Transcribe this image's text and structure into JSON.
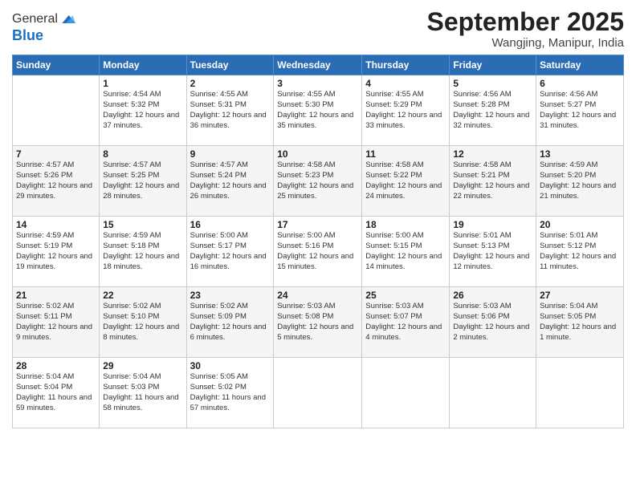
{
  "header": {
    "logo_line1": "General",
    "logo_line2": "Blue",
    "month_title": "September 2025",
    "location": "Wangjing, Manipur, India"
  },
  "days_of_week": [
    "Sunday",
    "Monday",
    "Tuesday",
    "Wednesday",
    "Thursday",
    "Friday",
    "Saturday"
  ],
  "weeks": [
    [
      {
        "day": "",
        "sunrise": "",
        "sunset": "",
        "daylight": ""
      },
      {
        "day": "1",
        "sunrise": "Sunrise: 4:54 AM",
        "sunset": "Sunset: 5:32 PM",
        "daylight": "Daylight: 12 hours and 37 minutes."
      },
      {
        "day": "2",
        "sunrise": "Sunrise: 4:55 AM",
        "sunset": "Sunset: 5:31 PM",
        "daylight": "Daylight: 12 hours and 36 minutes."
      },
      {
        "day": "3",
        "sunrise": "Sunrise: 4:55 AM",
        "sunset": "Sunset: 5:30 PM",
        "daylight": "Daylight: 12 hours and 35 minutes."
      },
      {
        "day": "4",
        "sunrise": "Sunrise: 4:55 AM",
        "sunset": "Sunset: 5:29 PM",
        "daylight": "Daylight: 12 hours and 33 minutes."
      },
      {
        "day": "5",
        "sunrise": "Sunrise: 4:56 AM",
        "sunset": "Sunset: 5:28 PM",
        "daylight": "Daylight: 12 hours and 32 minutes."
      },
      {
        "day": "6",
        "sunrise": "Sunrise: 4:56 AM",
        "sunset": "Sunset: 5:27 PM",
        "daylight": "Daylight: 12 hours and 31 minutes."
      }
    ],
    [
      {
        "day": "7",
        "sunrise": "Sunrise: 4:57 AM",
        "sunset": "Sunset: 5:26 PM",
        "daylight": "Daylight: 12 hours and 29 minutes."
      },
      {
        "day": "8",
        "sunrise": "Sunrise: 4:57 AM",
        "sunset": "Sunset: 5:25 PM",
        "daylight": "Daylight: 12 hours and 28 minutes."
      },
      {
        "day": "9",
        "sunrise": "Sunrise: 4:57 AM",
        "sunset": "Sunset: 5:24 PM",
        "daylight": "Daylight: 12 hours and 26 minutes."
      },
      {
        "day": "10",
        "sunrise": "Sunrise: 4:58 AM",
        "sunset": "Sunset: 5:23 PM",
        "daylight": "Daylight: 12 hours and 25 minutes."
      },
      {
        "day": "11",
        "sunrise": "Sunrise: 4:58 AM",
        "sunset": "Sunset: 5:22 PM",
        "daylight": "Daylight: 12 hours and 24 minutes."
      },
      {
        "day": "12",
        "sunrise": "Sunrise: 4:58 AM",
        "sunset": "Sunset: 5:21 PM",
        "daylight": "Daylight: 12 hours and 22 minutes."
      },
      {
        "day": "13",
        "sunrise": "Sunrise: 4:59 AM",
        "sunset": "Sunset: 5:20 PM",
        "daylight": "Daylight: 12 hours and 21 minutes."
      }
    ],
    [
      {
        "day": "14",
        "sunrise": "Sunrise: 4:59 AM",
        "sunset": "Sunset: 5:19 PM",
        "daylight": "Daylight: 12 hours and 19 minutes."
      },
      {
        "day": "15",
        "sunrise": "Sunrise: 4:59 AM",
        "sunset": "Sunset: 5:18 PM",
        "daylight": "Daylight: 12 hours and 18 minutes."
      },
      {
        "day": "16",
        "sunrise": "Sunrise: 5:00 AM",
        "sunset": "Sunset: 5:17 PM",
        "daylight": "Daylight: 12 hours and 16 minutes."
      },
      {
        "day": "17",
        "sunrise": "Sunrise: 5:00 AM",
        "sunset": "Sunset: 5:16 PM",
        "daylight": "Daylight: 12 hours and 15 minutes."
      },
      {
        "day": "18",
        "sunrise": "Sunrise: 5:00 AM",
        "sunset": "Sunset: 5:15 PM",
        "daylight": "Daylight: 12 hours and 14 minutes."
      },
      {
        "day": "19",
        "sunrise": "Sunrise: 5:01 AM",
        "sunset": "Sunset: 5:13 PM",
        "daylight": "Daylight: 12 hours and 12 minutes."
      },
      {
        "day": "20",
        "sunrise": "Sunrise: 5:01 AM",
        "sunset": "Sunset: 5:12 PM",
        "daylight": "Daylight: 12 hours and 11 minutes."
      }
    ],
    [
      {
        "day": "21",
        "sunrise": "Sunrise: 5:02 AM",
        "sunset": "Sunset: 5:11 PM",
        "daylight": "Daylight: 12 hours and 9 minutes."
      },
      {
        "day": "22",
        "sunrise": "Sunrise: 5:02 AM",
        "sunset": "Sunset: 5:10 PM",
        "daylight": "Daylight: 12 hours and 8 minutes."
      },
      {
        "day": "23",
        "sunrise": "Sunrise: 5:02 AM",
        "sunset": "Sunset: 5:09 PM",
        "daylight": "Daylight: 12 hours and 6 minutes."
      },
      {
        "day": "24",
        "sunrise": "Sunrise: 5:03 AM",
        "sunset": "Sunset: 5:08 PM",
        "daylight": "Daylight: 12 hours and 5 minutes."
      },
      {
        "day": "25",
        "sunrise": "Sunrise: 5:03 AM",
        "sunset": "Sunset: 5:07 PM",
        "daylight": "Daylight: 12 hours and 4 minutes."
      },
      {
        "day": "26",
        "sunrise": "Sunrise: 5:03 AM",
        "sunset": "Sunset: 5:06 PM",
        "daylight": "Daylight: 12 hours and 2 minutes."
      },
      {
        "day": "27",
        "sunrise": "Sunrise: 5:04 AM",
        "sunset": "Sunset: 5:05 PM",
        "daylight": "Daylight: 12 hours and 1 minute."
      }
    ],
    [
      {
        "day": "28",
        "sunrise": "Sunrise: 5:04 AM",
        "sunset": "Sunset: 5:04 PM",
        "daylight": "Daylight: 11 hours and 59 minutes."
      },
      {
        "day": "29",
        "sunrise": "Sunrise: 5:04 AM",
        "sunset": "Sunset: 5:03 PM",
        "daylight": "Daylight: 11 hours and 58 minutes."
      },
      {
        "day": "30",
        "sunrise": "Sunrise: 5:05 AM",
        "sunset": "Sunset: 5:02 PM",
        "daylight": "Daylight: 11 hours and 57 minutes."
      },
      {
        "day": "",
        "sunrise": "",
        "sunset": "",
        "daylight": ""
      },
      {
        "day": "",
        "sunrise": "",
        "sunset": "",
        "daylight": ""
      },
      {
        "day": "",
        "sunrise": "",
        "sunset": "",
        "daylight": ""
      },
      {
        "day": "",
        "sunrise": "",
        "sunset": "",
        "daylight": ""
      }
    ]
  ]
}
